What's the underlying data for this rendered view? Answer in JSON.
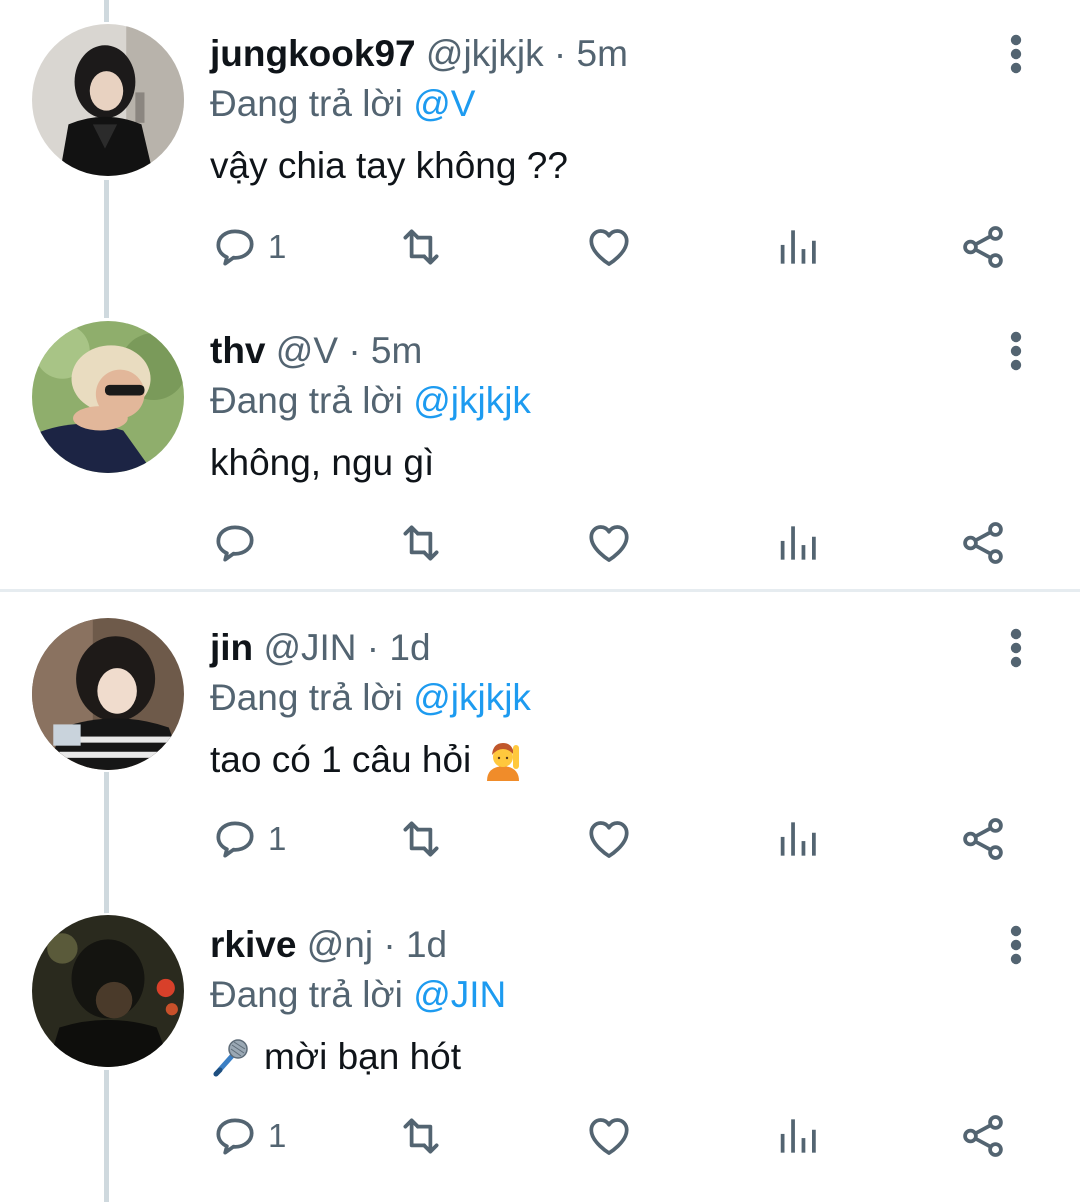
{
  "icon_color": "#536471",
  "link_color": "#1d9bf0",
  "tweets": [
    {
      "name": "jungkook97",
      "handle": "@jkjkjk",
      "dot": "·",
      "time": "5m",
      "reply_prefix": "Đang trả lời",
      "reply_to": "@V",
      "text": "vậy chia tay không ??",
      "reply_count": "1",
      "icons": [
        "reply-icon",
        "retweet-icon",
        "like-icon",
        "views-icon",
        "share-icon",
        "more-icon"
      ]
    },
    {
      "name": "thv",
      "handle": "@V",
      "dot": "·",
      "time": "5m",
      "reply_prefix": "Đang trả lời",
      "reply_to": "@jkjkjk",
      "text": "không, ngu gì",
      "reply_count": "",
      "icons": [
        "reply-icon",
        "retweet-icon",
        "like-icon",
        "views-icon",
        "share-icon",
        "more-icon"
      ]
    },
    {
      "name": "jin",
      "handle": "@JIN",
      "dot": "·",
      "time": "1d",
      "reply_prefix": "Đang trả lời",
      "reply_to": "@jkjkjk",
      "text": "tao có 1 câu hỏi",
      "emoji": "raising-hand-emoji",
      "reply_count": "1",
      "icons": [
        "reply-icon",
        "retweet-icon",
        "like-icon",
        "views-icon",
        "share-icon",
        "more-icon"
      ]
    },
    {
      "name": "rkive",
      "handle": "@nj",
      "dot": "·",
      "time": "1d",
      "reply_prefix": "Đang trả lời",
      "reply_to": "@JIN",
      "text": "mời bạn hót",
      "emoji": "microphone-emoji",
      "reply_count": "1",
      "icons": [
        "reply-icon",
        "retweet-icon",
        "like-icon",
        "views-icon",
        "share-icon",
        "more-icon"
      ]
    }
  ]
}
